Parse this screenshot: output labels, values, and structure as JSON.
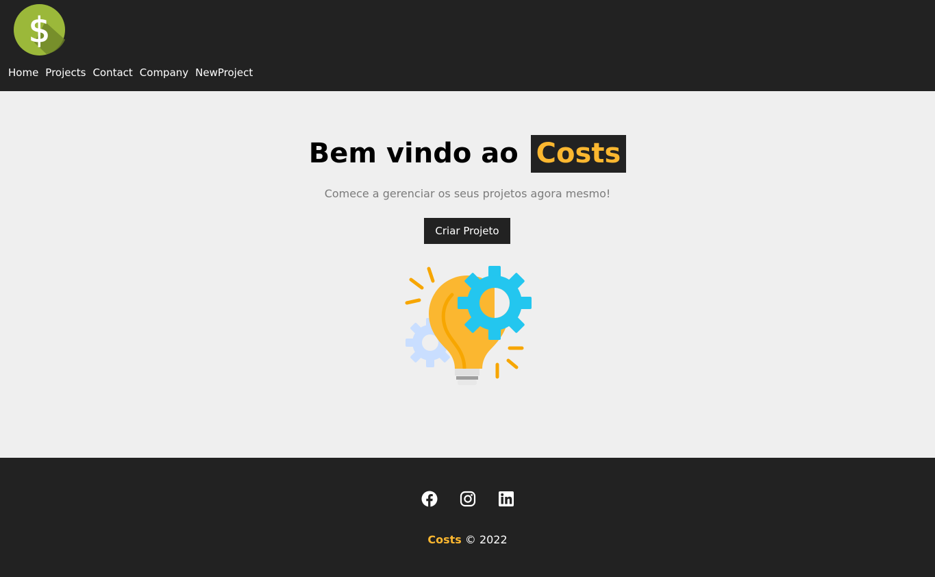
{
  "navbar": {
    "logo_alt": "Costs",
    "links": [
      "Home",
      "Projects",
      "Contact",
      "Company",
      "NewProject"
    ]
  },
  "hero": {
    "title_prefix": "Bem vindo ao",
    "title_brand": "Costs",
    "subtitle": "Comece a gerenciar os seus projetos agora mesmo!",
    "cta_label": "Criar Projeto",
    "illustration_alt": "Costs"
  },
  "footer": {
    "social_icons": [
      "facebook-icon",
      "instagram-icon",
      "linkedin-icon"
    ],
    "brand": "Costs",
    "copyright_suffix": "© 2022"
  },
  "colors": {
    "dark": "#222222",
    "accent": "#fbb730",
    "background": "#efefef"
  }
}
